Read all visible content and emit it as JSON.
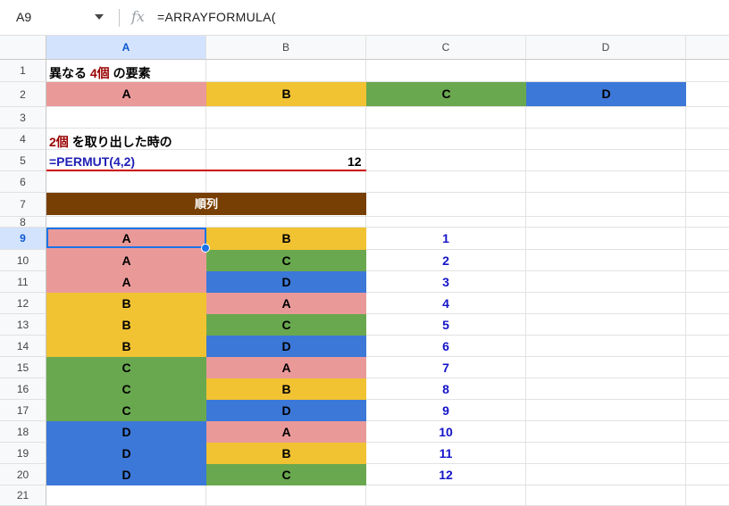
{
  "formula_bar": {
    "name_box": "A9",
    "fx_label": "fx",
    "formula": "=ARRAYFORMULA("
  },
  "columns": [
    "A",
    "B",
    "C",
    "D"
  ],
  "rows": [
    "1",
    "2",
    "3",
    "4",
    "5",
    "6",
    "7",
    "8",
    "9",
    "10",
    "11",
    "12",
    "13",
    "14",
    "15",
    "16",
    "17",
    "18",
    "19",
    "20",
    "21"
  ],
  "selected_cell": "A9",
  "row1": {
    "part1": "異なる",
    "part2": "4個",
    "part3": "の要素"
  },
  "row2_elements": [
    "A",
    "B",
    "C",
    "D"
  ],
  "row4": {
    "part1": "2個",
    "part2": "を取り出した時の"
  },
  "row5": {
    "formula_text": "=PERMUT(4,2)",
    "result": "12"
  },
  "row7_header": "順列",
  "permutations": [
    {
      "a": "A",
      "b": "B",
      "n": "1"
    },
    {
      "a": "A",
      "b": "C",
      "n": "2"
    },
    {
      "a": "A",
      "b": "D",
      "n": "3"
    },
    {
      "a": "B",
      "b": "A",
      "n": "4"
    },
    {
      "a": "B",
      "b": "C",
      "n": "5"
    },
    {
      "a": "B",
      "b": "D",
      "n": "6"
    },
    {
      "a": "C",
      "b": "A",
      "n": "7"
    },
    {
      "a": "C",
      "b": "B",
      "n": "8"
    },
    {
      "a": "C",
      "b": "D",
      "n": "9"
    },
    {
      "a": "D",
      "b": "A",
      "n": "10"
    },
    {
      "a": "D",
      "b": "B",
      "n": "11"
    },
    {
      "a": "D",
      "b": "C",
      "n": "12"
    }
  ],
  "colors": {
    "A": "#ea9999",
    "B": "#f1c232",
    "C": "#6aa84f",
    "D": "#3c78d8",
    "header_bg": "#783f04",
    "header_text": "#ffffff",
    "selection": "#1a73e8"
  }
}
